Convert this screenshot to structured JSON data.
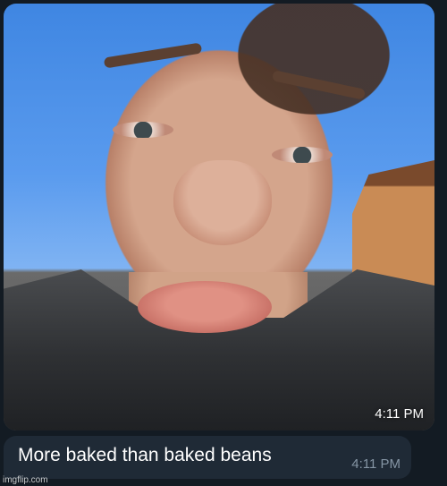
{
  "photo_message": {
    "time": "4:11 PM"
  },
  "text_message": {
    "text": "More baked than baked beans",
    "time": "4:11 PM"
  },
  "watermark": "imgflip.com",
  "colors": {
    "background": "#131b23",
    "bubble": "#1f2a36",
    "text": "#ffffff",
    "timestamp_muted": "#8595a4"
  }
}
